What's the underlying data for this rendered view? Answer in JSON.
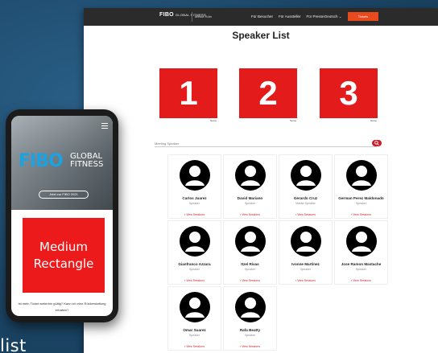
{
  "caption": "list",
  "topbar": {
    "logo": "FIBO",
    "logo_sub": "GLOBAL FITNESS",
    "location": "Messe Köln",
    "nav": [
      "Für Besucher",
      "Für Aussteller",
      "Für Presse"
    ],
    "language": "Deutsch",
    "cta": "Tickets"
  },
  "page_title": "Speaker List",
  "sponsors": [
    {
      "number": "1",
      "label": "Name"
    },
    {
      "number": "2",
      "label": "Name"
    },
    {
      "number": "3",
      "label": "Name"
    }
  ],
  "search": {
    "placeholder": "Meeting Speaker"
  },
  "speakers": [
    {
      "name": "Carlos Juarez",
      "role": "Speaker",
      "link": "View Sessions"
    },
    {
      "name": "David Mariano",
      "role": "Speaker",
      "link": "View Sessions"
    },
    {
      "name": "Gerardo Cruz",
      "role": "Master Speaker",
      "link": "View Sessions"
    },
    {
      "name": "German Perez Maldonado",
      "role": "Speaker",
      "link": "View Sessions"
    },
    {
      "name": "Gianfranco Azzara",
      "role": "Speaker",
      "link": "View Sessions"
    },
    {
      "name": "Itzel Rivas",
      "role": "Speaker",
      "link": "View Sessions"
    },
    {
      "name": "Ivonne Martinez",
      "role": "Speaker",
      "link": "View Sessions"
    },
    {
      "name": "Jose Ramon Mastache",
      "role": "Speaker",
      "link": "View Sessions"
    },
    {
      "name": "Omar Suarez",
      "role": "Speaker",
      "link": "View Sessions"
    },
    {
      "name": "Rafa Beatty",
      "role": "Speaker",
      "link": "View Sessions"
    }
  ],
  "phone": {
    "logo": "FIBO",
    "logo_sub_1": "GLOBAL",
    "logo_sub_2": "FITNESS",
    "hero_button": "Jetzt zur FIBO 2021",
    "ad_line_1": "Medium",
    "ad_line_2": "Rectangle",
    "footer_1": "Ist mein Ticket weiterhin gültig? Kann ich eine Rückerstattung",
    "footer_2": "erhalten?"
  },
  "colors": {
    "accent": "#e31b1b",
    "topbar": "#2b2b2b",
    "cta": "#e8491d",
    "brand_blue": "#1aa3e0"
  }
}
